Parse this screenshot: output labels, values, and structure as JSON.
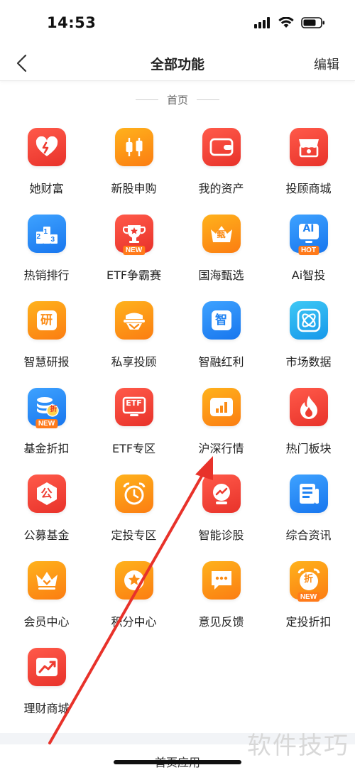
{
  "status": {
    "time": "14:53"
  },
  "nav": {
    "title": "全部功能",
    "edit_label": "编辑"
  },
  "section": {
    "title": "首页"
  },
  "colors": {
    "red": "#ee3b30",
    "orange": "#fb8c16",
    "blue": "#1f82f2",
    "cyan": "#21a6ee",
    "annotation_arrow": "#e8322a"
  },
  "items": [
    {
      "label": "她财富",
      "icon": "heart-icon",
      "color": "red"
    },
    {
      "label": "新股申购",
      "icon": "candlestick-icon",
      "color": "orange"
    },
    {
      "label": "我的资产",
      "icon": "wallet-icon",
      "color": "red"
    },
    {
      "label": "投顾商城",
      "icon": "shop-icon",
      "color": "red"
    },
    {
      "label": "热销排行",
      "icon": "podium-icon",
      "color": "blue",
      "glyphs": [
        "2",
        "1",
        "3"
      ]
    },
    {
      "label": "ETF争霸赛",
      "icon": "trophy-icon",
      "color": "red",
      "tag": "NEW"
    },
    {
      "label": "国海甄选",
      "icon": "crown-icon",
      "color": "orange",
      "glyph": "甄"
    },
    {
      "label": "Ai智投",
      "icon": "ai-icon",
      "color": "blue",
      "glyph": "AI",
      "tag": "HOT"
    },
    {
      "label": "智慧研报",
      "icon": "report-icon",
      "color": "orange",
      "glyph": "研"
    },
    {
      "label": "私享投顾",
      "icon": "private-advisor-icon",
      "color": "orange"
    },
    {
      "label": "智融红利",
      "icon": "dividend-icon",
      "color": "blue",
      "glyph": "智"
    },
    {
      "label": "市场数据",
      "icon": "data-icon",
      "color": "cyan"
    },
    {
      "label": "基金折扣",
      "icon": "fund-discount-icon",
      "color": "blue",
      "glyph": "折",
      "tag": "NEW"
    },
    {
      "label": "ETF专区",
      "icon": "etf-icon",
      "color": "red",
      "glyph": "ETF"
    },
    {
      "label": "沪深行情",
      "icon": "bar-chart-icon",
      "color": "orange"
    },
    {
      "label": "热门板块",
      "icon": "flame-icon",
      "color": "red"
    },
    {
      "label": "公募基金",
      "icon": "public-fund-icon",
      "color": "red",
      "glyph": "公"
    },
    {
      "label": "定投专区",
      "icon": "alarm-clock-icon",
      "color": "orange"
    },
    {
      "label": "智能诊股",
      "icon": "diagnosis-icon",
      "color": "red"
    },
    {
      "label": "综合资讯",
      "icon": "news-icon",
      "color": "blue"
    },
    {
      "label": "会员中心",
      "icon": "vip-crown-icon",
      "color": "orange"
    },
    {
      "label": "积分中心",
      "icon": "points-icon",
      "color": "orange"
    },
    {
      "label": "意见反馈",
      "icon": "feedback-icon",
      "color": "orange"
    },
    {
      "label": "定投折扣",
      "icon": "alarm-discount-icon",
      "color": "orange",
      "glyph": "折",
      "tag": "NEW"
    },
    {
      "label": "理财商城",
      "icon": "trend-up-icon",
      "color": "red"
    }
  ],
  "bottom": {
    "tab_label": "首页应用"
  },
  "watermark": "软件技巧"
}
